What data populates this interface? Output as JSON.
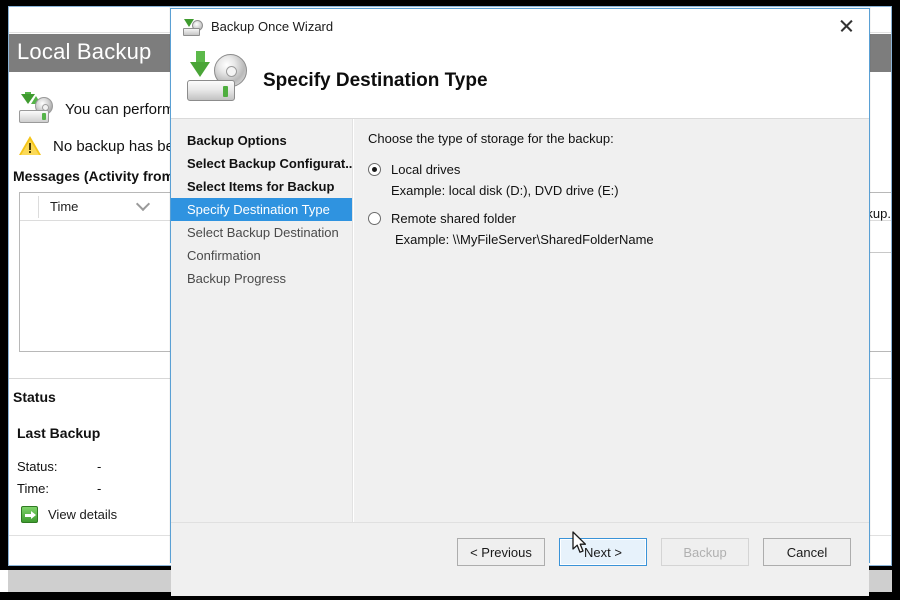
{
  "background_window": {
    "header_title": "Local Backup",
    "perform_text": "You can perform",
    "warning_text": "No backup has been",
    "messages_label": "Messages (Activity from last",
    "table": {
      "columns": [
        "Time"
      ]
    },
    "right_clipped_text": "ckup.",
    "status": {
      "section_title": "Status",
      "last_backup_title": "Last Backup",
      "status_label": "Status:",
      "status_value": "-",
      "time_label": "Time:",
      "time_value": "-",
      "view_details_label": "View details"
    }
  },
  "wizard": {
    "title": "Backup Once Wizard",
    "banner_title": "Specify Destination Type",
    "close_label": "×",
    "nav": {
      "items": [
        {
          "label": "Backup Options",
          "state": "done"
        },
        {
          "label": "Select Backup Configurat...",
          "state": "done"
        },
        {
          "label": "Select Items for Backup",
          "state": "done"
        },
        {
          "label": "Specify Destination Type",
          "state": "current"
        },
        {
          "label": "Select Backup Destination",
          "state": "pending"
        },
        {
          "label": "Confirmation",
          "state": "pending"
        },
        {
          "label": "Backup Progress",
          "state": "pending"
        }
      ]
    },
    "content": {
      "prompt": "Choose the type of storage for the backup:",
      "options": [
        {
          "label": "Local drives",
          "example": "Example: local disk (D:), DVD drive (E:)",
          "selected": true
        },
        {
          "label": "Remote shared folder",
          "example": "Example: \\\\MyFileServer\\SharedFolderName",
          "selected": false
        }
      ]
    },
    "footer": {
      "previous_label": "< Previous",
      "next_label": "Next >",
      "backup_label": "Backup",
      "cancel_label": "Cancel"
    }
  },
  "colors": {
    "nav_highlight": "#2f93e0",
    "dialog_border": "#5aa0d4",
    "content_bg": "#f0f0f0",
    "header_bar": "#7d7d7d",
    "focus_border": "#3a93d8"
  }
}
